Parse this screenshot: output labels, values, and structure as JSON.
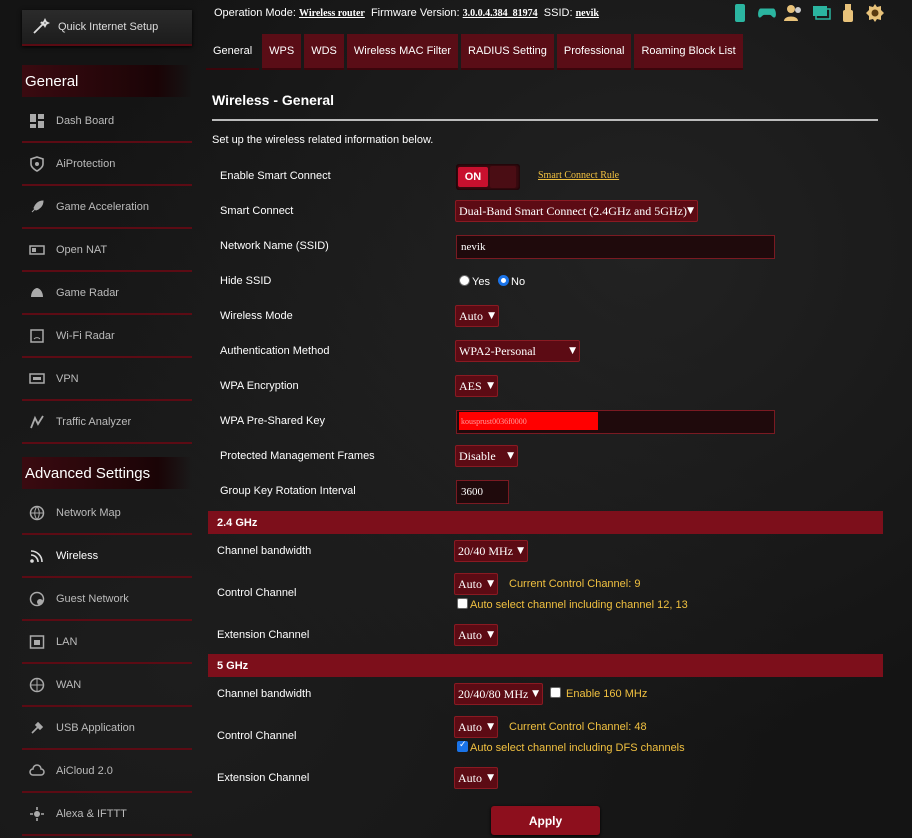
{
  "sidebar": {
    "quick_setup": "Quick Internet Setup",
    "general_title": "General",
    "general_items": [
      {
        "label": "Dash Board",
        "icon": "dashboard-icon"
      },
      {
        "label": "AiProtection",
        "icon": "shield-icon"
      },
      {
        "label": "Game Acceleration",
        "icon": "rocket-icon"
      },
      {
        "label": "Open NAT",
        "icon": "nat-icon"
      },
      {
        "label": "Game Radar",
        "icon": "radar-icon"
      },
      {
        "label": "Wi-Fi Radar",
        "icon": "wifi-radar-icon"
      },
      {
        "label": "VPN",
        "icon": "vpn-icon"
      },
      {
        "label": "Traffic Analyzer",
        "icon": "traffic-icon"
      }
    ],
    "advanced_title": "Advanced Settings",
    "advanced_items": [
      {
        "label": "Network Map",
        "icon": "globe-icon"
      },
      {
        "label": "Wireless",
        "icon": "wifi-icon"
      },
      {
        "label": "Guest Network",
        "icon": "guest-globe-icon"
      },
      {
        "label": "LAN",
        "icon": "lan-icon"
      },
      {
        "label": "WAN",
        "icon": "wan-globe-icon"
      },
      {
        "label": "USB Application",
        "icon": "usb-icon"
      },
      {
        "label": "AiCloud 2.0",
        "icon": "cloud-icon"
      },
      {
        "label": "Alexa & IFTTT",
        "icon": "alexa-icon"
      }
    ]
  },
  "topbar": {
    "op_mode_label": "Operation Mode:",
    "op_mode_value": "Wireless router",
    "fw_label": "Firmware Version:",
    "fw_value": "3.0.0.4.384_81974",
    "ssid_label": "SSID:",
    "ssid_value": "nevik"
  },
  "tabs": [
    "General",
    "WPS",
    "WDS",
    "Wireless MAC Filter",
    "RADIUS Setting",
    "Professional",
    "Roaming Block List"
  ],
  "page": {
    "title": "Wireless - General",
    "description": "Set up the wireless related information below."
  },
  "form": {
    "smart_connect_label": "Enable Smart Connect",
    "smart_connect_toggle": "ON",
    "smart_connect_rule": "Smart Connect Rule",
    "smart_connect_mode_label": "Smart Connect",
    "smart_connect_mode_value": "Dual-Band Smart Connect (2.4GHz and 5GHz)",
    "ssid_label": "Network Name (SSID)",
    "ssid_value": "nevik",
    "hide_ssid_label": "Hide SSID",
    "hide_yes": "Yes",
    "hide_no": "No",
    "wireless_mode_label": "Wireless Mode",
    "wireless_mode_value": "Auto",
    "auth_label": "Authentication Method",
    "auth_value": "WPA2-Personal",
    "wpa_enc_label": "WPA Encryption",
    "wpa_enc_value": "AES",
    "psk_label": "WPA Pre-Shared Key",
    "psk_value": "kousprust0036f0000",
    "pmf_label": "Protected Management Frames",
    "pmf_value": "Disable",
    "gkri_label": "Group Key Rotation Interval",
    "gkri_value": "3600"
  },
  "band24": {
    "header": "2.4 GHz",
    "bw_label": "Channel bandwidth",
    "bw_value": "20/40 MHz",
    "cc_label": "Control Channel",
    "cc_value": "Auto",
    "cc_current": "Current Control Channel: 9",
    "cc_auto_select": "Auto select channel including channel 12, 13",
    "ext_label": "Extension Channel",
    "ext_value": "Auto"
  },
  "band5": {
    "header": "5 GHz",
    "bw_label": "Channel bandwidth",
    "bw_value": "20/40/80 MHz",
    "enable160": "Enable 160 MHz",
    "cc_label": "Control Channel",
    "cc_value": "Auto",
    "cc_current": "Current Control Channel: 48",
    "cc_auto_select": "Auto select channel including DFS channels",
    "ext_label": "Extension Channel",
    "ext_value": "Auto"
  },
  "apply_label": "Apply",
  "colors": {
    "accent": "#7d0f1b",
    "tab": "#5a0d16",
    "highlight": "#f0c040"
  }
}
